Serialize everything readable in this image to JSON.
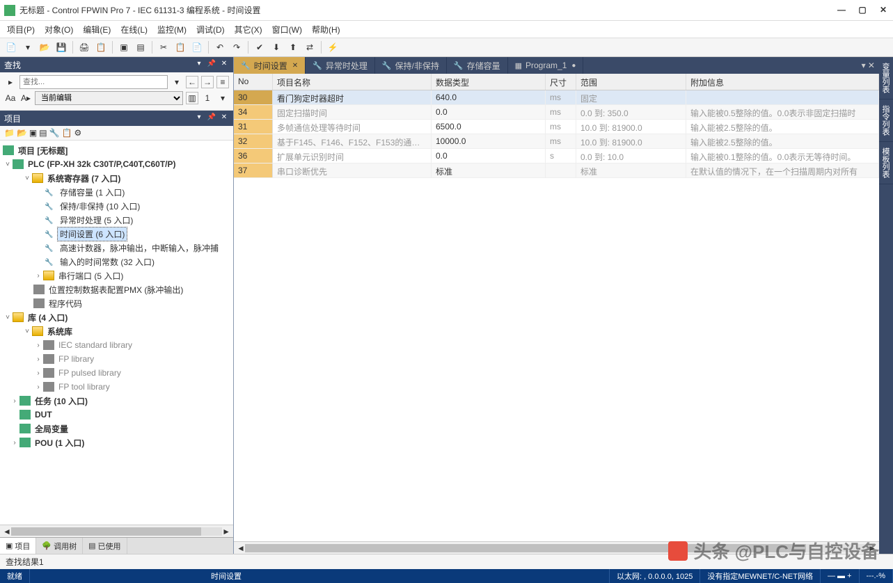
{
  "window": {
    "title": "无标题 - Control FPWIN Pro 7 - IEC 61131-3 编程系统 - 时间设置"
  },
  "menu": [
    "项目(P)",
    "对象(O)",
    "编辑(E)",
    "在线(L)",
    "监控(M)",
    "调试(D)",
    "其它(X)",
    "窗口(W)",
    "帮助(H)"
  ],
  "search_panel": {
    "title": "查找",
    "placeholder": "查找...",
    "scope": "当前编辑",
    "num": "1"
  },
  "project_panel": {
    "title": "项目",
    "root": "项目 [无标题]",
    "plc": "PLC (FP-XH 32k C30T/P,C40T,C60T/P)",
    "sysreg": "系统寄存器 (7 入口)",
    "items": {
      "storage": "存储容量 (1 入口)",
      "hold": "保持/非保持 (10 入口)",
      "excep": "异常时处理 (5 入口)",
      "time": "时间设置 (6 入口)",
      "hspeed": "高速计数器，脉冲输出，中断输入，脉冲捕",
      "timeconst": "输入的时间常数 (32 入口)",
      "serial": "串行端口 (5 入口)",
      "pmx": "位置控制数据表配置PMX (脉冲输出)",
      "code": "程序代码"
    },
    "lib": "库 (4 入口)",
    "syslib": "系统库",
    "libs": [
      "IEC standard library",
      "FP library",
      "FP pulsed library",
      "FP tool library"
    ],
    "tasks": "任务 (10 入口)",
    "dut": "DUT",
    "global": "全局变量",
    "pou": "POU (1 入口)",
    "bottom_tabs": [
      "项目",
      "调用树",
      "已使用"
    ]
  },
  "tabs": [
    {
      "label": "时间设置",
      "icon": "🔧",
      "active": true,
      "close": true
    },
    {
      "label": "异常时处理",
      "icon": "🔧"
    },
    {
      "label": "保持/非保持",
      "icon": "🔧"
    },
    {
      "label": "存储容量",
      "icon": "🔧"
    },
    {
      "label": "Program_1",
      "icon": "▦",
      "dirty": true
    }
  ],
  "grid": {
    "headers": {
      "no": "No",
      "name": "项目名称",
      "type": "数据类型",
      "unit": "尺寸",
      "range": "范围",
      "info": "附加信息"
    },
    "rows": [
      {
        "no": "30",
        "name": "看门狗定时器超时",
        "type": "640.0",
        "unit": "ms",
        "range": "固定",
        "info": "",
        "sel": true
      },
      {
        "no": "34",
        "name": "固定扫描时间",
        "type": "0.0",
        "unit": "ms",
        "range": "0.0 到: 350.0",
        "info": "输入能被0.5整除的值。0.0表示非固定扫描时"
      },
      {
        "no": "31",
        "name": "多帧通信处理等待时间",
        "type": "6500.0",
        "unit": "ms",
        "range": "10.0 到: 81900.0",
        "info": "输入能被2.5整除的值。"
      },
      {
        "no": "32",
        "name": "基于F145、F146、F152、F153的通信...",
        "type": "10000.0",
        "unit": "ms",
        "range": "10.0 到: 81900.0",
        "info": "输入能被2.5整除的值。"
      },
      {
        "no": "36",
        "name": "扩展单元识别时间",
        "type": "0.0",
        "unit": "s",
        "range": "0.0 到: 10.0",
        "info": "输入能被0.1整除的值。0.0表示无等待时间。"
      },
      {
        "no": "37",
        "name": "串口诊断优先",
        "type": "标准",
        "unit": "",
        "range": "标准",
        "info": "在默认值的情况下，在一个扫描周期内对所有"
      }
    ]
  },
  "sidebar_items": [
    "变量列表",
    "指令列表",
    "模板列表"
  ],
  "findresult": "查找结果1",
  "status": {
    "ready": "就绪",
    "context": "时间设置",
    "net1": "以太网: , 0.0.0.0, 1025",
    "net2": "没有指定MEWNET/C-NET网络",
    "pct": "---.-%"
  },
  "watermark": "头条 @PLC与自控设备"
}
